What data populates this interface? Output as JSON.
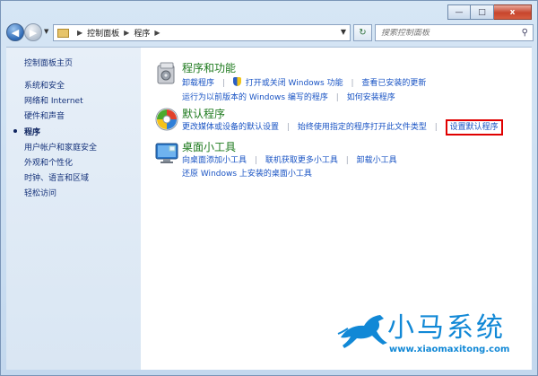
{
  "window": {
    "controls": {
      "minimize": "—",
      "maximize": "□",
      "close": "x"
    }
  },
  "nav": {
    "back_glyph": "◀",
    "forward_glyph": "▶",
    "breadcrumb": [
      "控制面板",
      "程序"
    ],
    "search_placeholder": "搜索控制面板"
  },
  "sidebar": {
    "items": [
      {
        "label": "控制面板主页"
      },
      {
        "label": "系统和安全"
      },
      {
        "label": "网络和 Internet"
      },
      {
        "label": "硬件和声音"
      },
      {
        "label": "程序",
        "current": true
      },
      {
        "label": "用户帐户和家庭安全"
      },
      {
        "label": "外观和个性化"
      },
      {
        "label": "时钟、语言和区域"
      },
      {
        "label": "轻松访问"
      }
    ]
  },
  "categories": [
    {
      "title": "程序和功能",
      "icon": "programs-features-icon",
      "links": [
        [
          "卸载程序",
          "打开或关闭 Windows 功能",
          "查看已安装的更新"
        ],
        [
          "运行为以前版本的 Windows 编写的程序",
          "如何安装程序"
        ]
      ]
    },
    {
      "title": "默认程序",
      "icon": "default-programs-icon",
      "links": [
        [
          "更改媒体或设备的默认设置",
          "始终使用指定的程序打开此文件类型",
          "设置默认程序"
        ]
      ]
    },
    {
      "title": "桌面小工具",
      "icon": "desktop-gadgets-icon",
      "links": [
        [
          "向桌面添加小工具",
          "联机获取更多小工具",
          "卸载小工具"
        ],
        [
          "还原 Windows 上安装的桌面小工具"
        ]
      ]
    }
  ],
  "watermark": {
    "title": "小马系统",
    "url": "www.xiaomaxitong.com"
  },
  "colors": {
    "link": "#1a54c4",
    "category_title": "#1e7a1e",
    "highlight_box": "#e00000",
    "watermark": "#1188d6"
  }
}
